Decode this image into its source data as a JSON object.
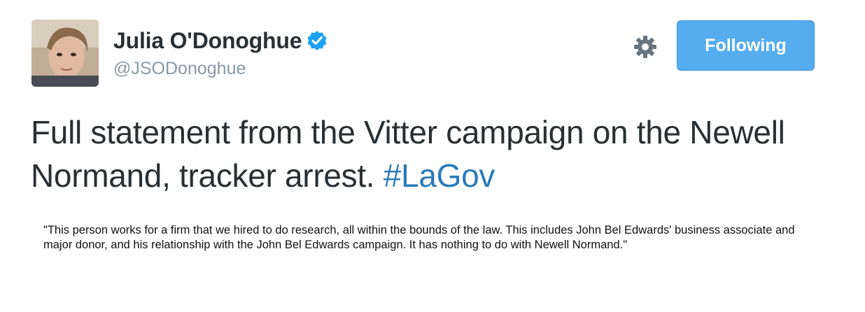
{
  "author": {
    "display_name": "Julia O'Donoghue",
    "handle": "@JSODonoghue",
    "verified": true
  },
  "actions": {
    "follow_label": "Following",
    "settings_icon": "gear-icon"
  },
  "tweet": {
    "text": "Full statement from the Vitter campaign on the Newell Normand, tracker arrest.",
    "hashtag": "#LaGov"
  },
  "attachment": {
    "quote": "\"This person works for a firm that we hired to do research, all within the bounds of the law. This includes John Bel Edwards' business associate and major donor, and his relationship with the John Bel Edwards campaign. It has nothing to do with Newell Normand.\""
  },
  "colors": {
    "accent": "#55acee",
    "hashtag": "#2b7bb9",
    "verified": "#1da1f2",
    "handle": "#8899a6",
    "text": "#292f33"
  }
}
